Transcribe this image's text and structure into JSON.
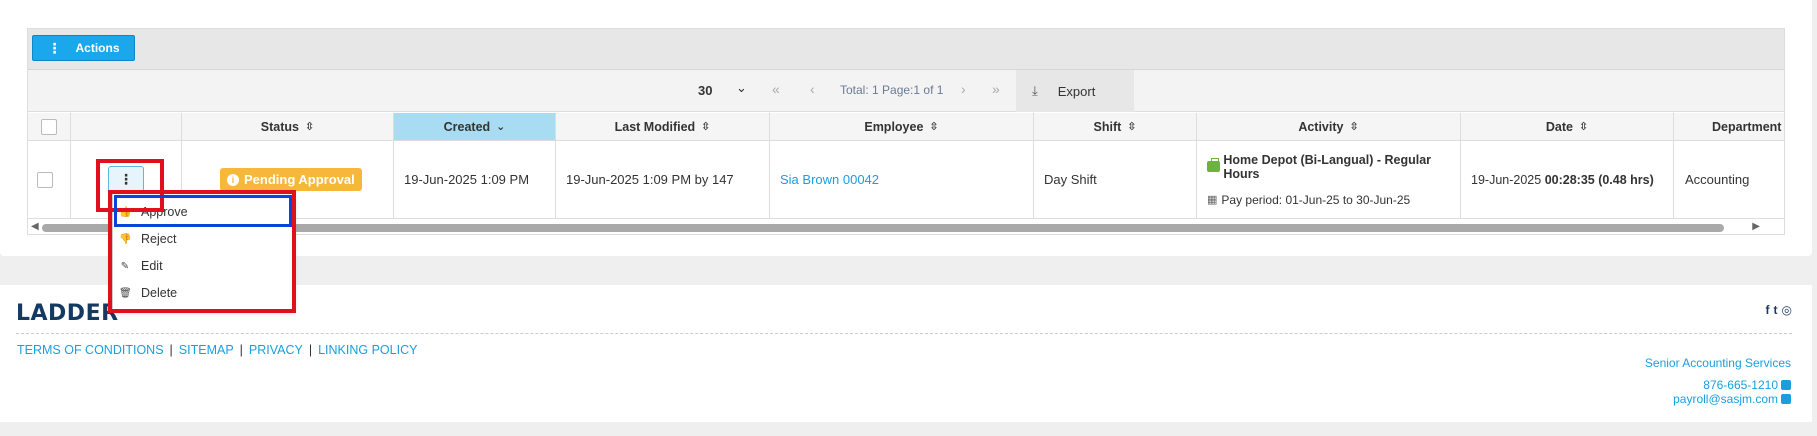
{
  "toolbar": {
    "actions_label": "Actions"
  },
  "pager": {
    "page_size": "30",
    "total_text": "Total: 1 Page:1 of 1",
    "export_label": "Export"
  },
  "columns": {
    "status": "Status",
    "created": "Created",
    "last_modified": "Last Modified",
    "employee": "Employee",
    "shift": "Shift",
    "activity": "Activity",
    "date": "Date",
    "department": "Department"
  },
  "row": {
    "status": "Pending Approval",
    "created": "19-Jun-2025 1:09 PM",
    "last_modified": "19-Jun-2025 1:09 PM by 147",
    "employee": "Sia Brown 00042",
    "shift": "Day Shift",
    "activity_title": "Home Depot (Bi-Langual) - Regular Hours",
    "activity_period": "Pay period: 01-Jun-25 to 30-Jun-25",
    "date": "19-Jun-2025",
    "duration": "00:28:35 (0.48 hrs)",
    "department": "Accounting"
  },
  "row_menu": {
    "items": [
      {
        "label": "Approve",
        "icon": "thumbs-up-icon"
      },
      {
        "label": "Reject",
        "icon": "thumbs-down-icon"
      },
      {
        "label": "Edit",
        "icon": "edit-icon"
      },
      {
        "label": "Delete",
        "icon": "trash-icon"
      }
    ]
  },
  "footer": {
    "logo": "LADDER",
    "links": [
      "TERMS OF CONDITIONS",
      "SITEMAP",
      "PRIVACY",
      "LINKING POLICY"
    ],
    "company": "Senior Accounting Services",
    "phone": "876-665-1210",
    "email": "payroll@sasjm.com"
  },
  "colors": {
    "accent": "#1aa7ec",
    "badge": "#f7b73a",
    "sorted_header": "#a7dcf3",
    "highlight_red": "#e0101e",
    "highlight_blue": "#0b44d9"
  }
}
